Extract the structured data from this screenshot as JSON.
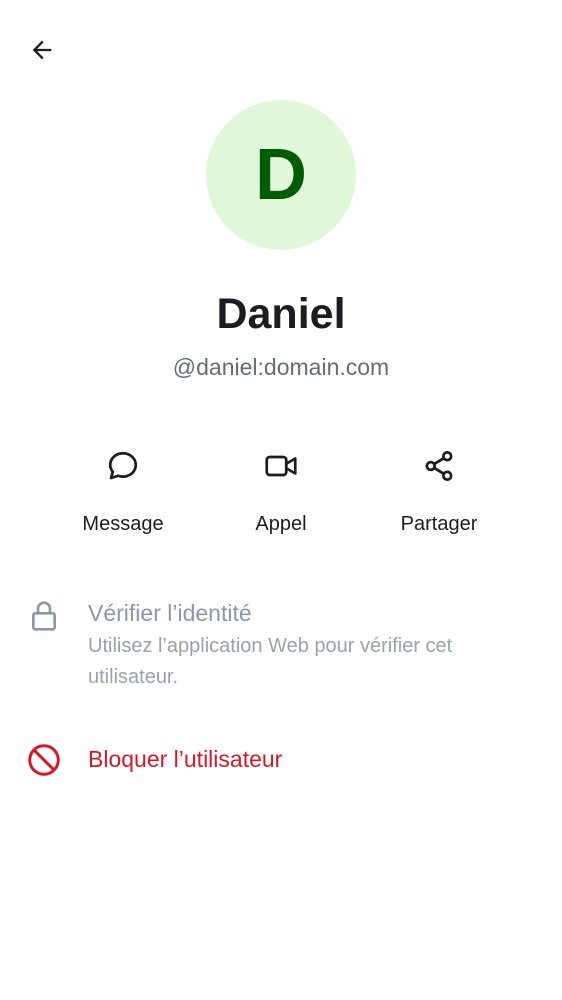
{
  "header": {
    "back_icon": "arrow-left-icon"
  },
  "profile": {
    "avatar_initial": "D",
    "avatar_bg_color": "#e0f8d9",
    "avatar_text_color": "#005c00",
    "name": "Daniel",
    "user_id": "@daniel:domain.com"
  },
  "actions": [
    {
      "label": "Message",
      "icon": "chat-bubble-icon"
    },
    {
      "label": "Appel",
      "icon": "video-camera-icon"
    },
    {
      "label": "Partager",
      "icon": "share-icon"
    }
  ],
  "verify": {
    "icon": "lock-icon",
    "title": "Vérifier l’identité",
    "subtitle": "Utilisez l’application Web pour vérifier cet utilisateur."
  },
  "block": {
    "icon": "block-icon",
    "title": "Bloquer l’utilisateur",
    "color": "#d51928"
  }
}
